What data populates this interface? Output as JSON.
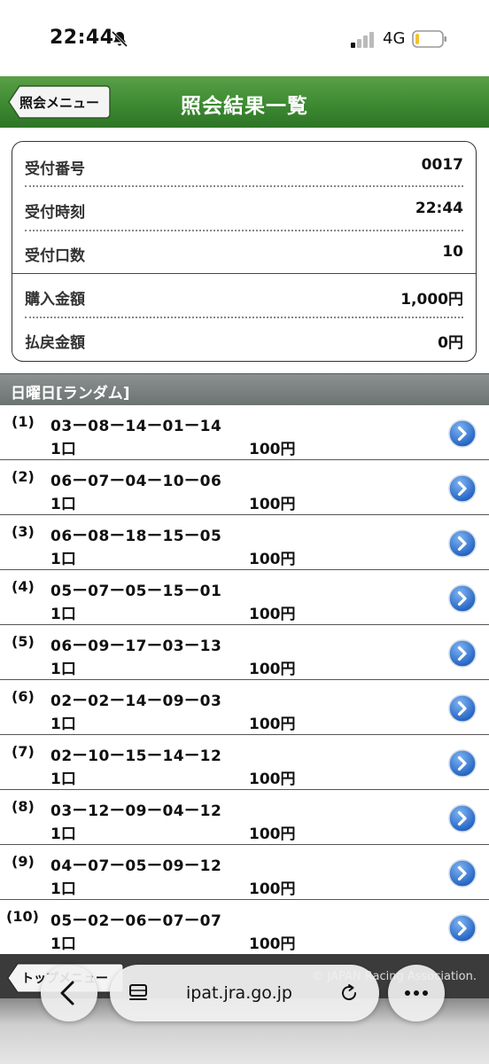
{
  "status_bar": {
    "time": "22:44",
    "network": "4G",
    "icons": [
      "bell-slash-icon",
      "signal-icon",
      "battery-icon"
    ]
  },
  "header": {
    "back_label": "照会メニュー",
    "title": "照会結果一覧"
  },
  "summary": {
    "receipt_number_label": "受付番号",
    "receipt_number": "0017",
    "receipt_time_label": "受付時刻",
    "receipt_time": "22:44",
    "receipt_count_label": "受付口数",
    "receipt_count": "10",
    "purchase_label": "購入金額",
    "purchase_amount": "1,000円",
    "refund_label": "払戻金額",
    "refund_amount": "0円"
  },
  "section": {
    "title": "日曜日[ランダム]"
  },
  "tickets": [
    {
      "index": "(1)",
      "combo": "03ー08ー14ー01ー14",
      "units": "1口",
      "amount": "100円"
    },
    {
      "index": "(2)",
      "combo": "06ー07ー04ー10ー06",
      "units": "1口",
      "amount": "100円"
    },
    {
      "index": "(3)",
      "combo": "06ー08ー18ー15ー05",
      "units": "1口",
      "amount": "100円"
    },
    {
      "index": "(4)",
      "combo": "05ー07ー05ー15ー01",
      "units": "1口",
      "amount": "100円"
    },
    {
      "index": "(5)",
      "combo": "06ー09ー17ー03ー13",
      "units": "1口",
      "amount": "100円"
    },
    {
      "index": "(6)",
      "combo": "02ー02ー14ー09ー03",
      "units": "1口",
      "amount": "100円"
    },
    {
      "index": "(7)",
      "combo": "02ー10ー15ー14ー12",
      "units": "1口",
      "amount": "100円"
    },
    {
      "index": "(8)",
      "combo": "03ー12ー09ー04ー12",
      "units": "1口",
      "amount": "100円"
    },
    {
      "index": "(9)",
      "combo": "04ー07ー05ー09ー12",
      "units": "1口",
      "amount": "100円"
    },
    {
      "index": "(10)",
      "combo": "05ー02ー06ー07ー07",
      "units": "1口",
      "amount": "100円"
    }
  ],
  "footer": {
    "top_button_label": "トップメニュー",
    "copyright": "© JAPAN Racing Association."
  },
  "browser": {
    "url": "ipat.jra.go.jp"
  }
}
